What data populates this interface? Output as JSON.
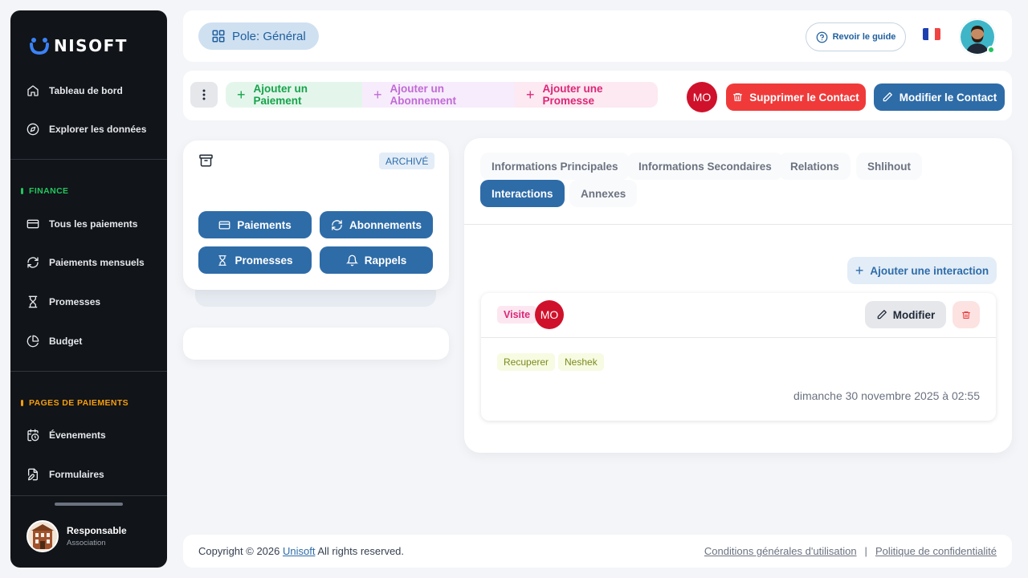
{
  "brand": {
    "name": "NISOFT"
  },
  "sidebar": {
    "items_top": [
      {
        "label": "Tableau de bord",
        "icon": "home-icon"
      },
      {
        "label": "Explorer les données",
        "icon": "compass-icon"
      }
    ],
    "finance": {
      "title": "FINANCE",
      "color": "#22c55e",
      "items": [
        {
          "label": "Tous les paiements",
          "icon": "credit-card-icon"
        },
        {
          "label": "Paiements mensuels",
          "icon": "refresh-icon"
        },
        {
          "label": "Promesses",
          "icon": "hourglass-icon"
        },
        {
          "label": "Budget",
          "icon": "pie-chart-icon"
        }
      ]
    },
    "pages": {
      "title": "PAGES DE PAIEMENTS",
      "color": "#f59e0b",
      "items": [
        {
          "label": "Évenements",
          "icon": "calendar-clock-icon"
        },
        {
          "label": "Formulaires",
          "icon": "file-edit-icon"
        }
      ]
    },
    "user": {
      "name": "Responsable",
      "role": "Association"
    }
  },
  "header": {
    "pole": "Pole: Général",
    "guide": "Revoir le guide",
    "language": "fr"
  },
  "actions": {
    "add_payment": "Ajouter un Paiement",
    "add_subscription": "Ajouter un Abonnement",
    "add_promise": "Ajouter une Promesse",
    "avatar_initials": "MO",
    "delete_contact": "Supprimer le Contact",
    "edit_contact": "Modifier le Contact"
  },
  "left_card": {
    "badge": "ARCHIVÉ",
    "buttons": {
      "payments": "Paiements",
      "subscriptions": "Abonnements",
      "promises": "Promesses",
      "reminders": "Rappels"
    }
  },
  "tabs": {
    "items": [
      "Informations Principales",
      "Informations Secondaires",
      "Relations",
      "Shlihout",
      "Interactions",
      "Annexes"
    ],
    "active": "Interactions"
  },
  "interactions": {
    "add_label": "Ajouter une interaction",
    "item": {
      "type": "Visite",
      "author_initials": "MO",
      "modify_label": "Modifier",
      "tags": [
        "Recuperer",
        "Neshek"
      ],
      "date": "dimanche 30 novembre 2025 à 02:55"
    }
  },
  "footer": {
    "copyright": "Copyright © 2026",
    "company": "Unisoft",
    "rights": "All rights reserved.",
    "terms": "Conditions générales d'utilisation",
    "separator": "|",
    "privacy": "Politique de confidentialité"
  },
  "colors": {
    "primary": "#2e6ca8",
    "danger": "#f03a3a",
    "avatar_red": "#d0112b",
    "sidebar_bg": "#111418"
  }
}
